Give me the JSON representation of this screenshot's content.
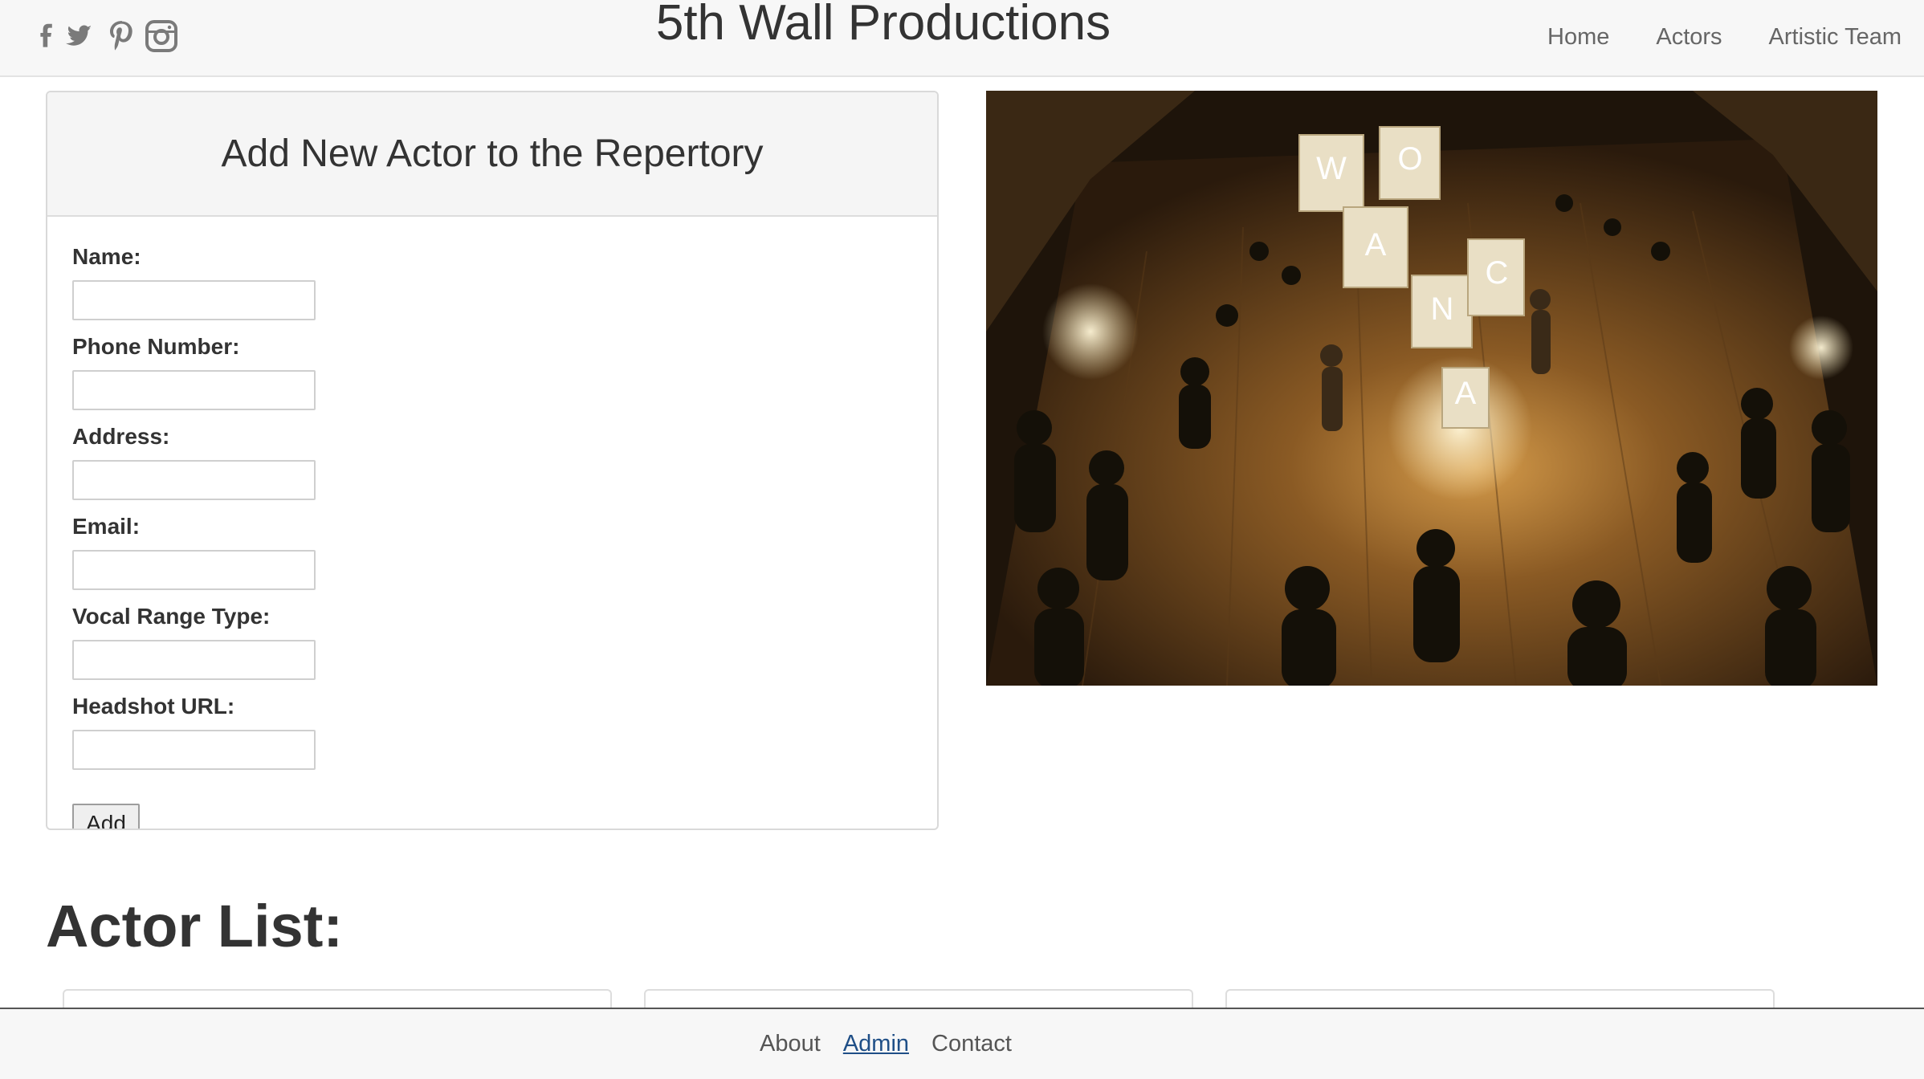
{
  "header": {
    "title": "5th Wall Productions",
    "social_icons": [
      "facebook-icon",
      "twitter-icon",
      "pinterest-icon",
      "instagram-icon"
    ],
    "nav": [
      {
        "label": "Home"
      },
      {
        "label": "Actors"
      },
      {
        "label": "Artistic Team"
      }
    ]
  },
  "form": {
    "heading": "Add New Actor to the Repertory",
    "fields": [
      {
        "label": "Name:",
        "value": "",
        "placeholder": ""
      },
      {
        "label": "Phone Number:",
        "value": "",
        "placeholder": ""
      },
      {
        "label": "Address:",
        "value": "",
        "placeholder": ""
      },
      {
        "label": "Email:",
        "value": "",
        "placeholder": ""
      },
      {
        "label": "Vocal Range Type:",
        "value": "",
        "placeholder": ""
      },
      {
        "label": "Headshot URL:",
        "value": "",
        "placeholder": ""
      }
    ],
    "submit_label": "Add"
  },
  "photo": {
    "cube_letters": [
      "W",
      "O",
      "A",
      "N",
      "C",
      "A"
    ]
  },
  "actor_list": {
    "heading": "Actor List:"
  },
  "footer": {
    "links": [
      {
        "label": "About"
      },
      {
        "label": "Admin",
        "active": true
      },
      {
        "label": "Contact"
      }
    ]
  },
  "colors": {
    "header_bg": "#f7f7f7",
    "text": "#333333",
    "nav_text": "#666666",
    "active_link": "#1f4f87",
    "panel_border": "#d9d9d9"
  }
}
